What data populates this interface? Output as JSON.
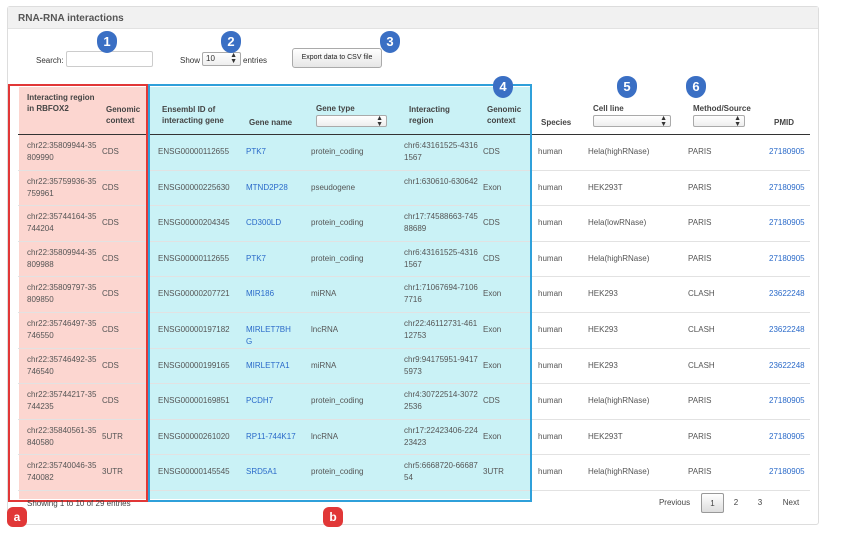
{
  "panel": {
    "title": "RNA-RNA interactions"
  },
  "controls": {
    "search_label": "Search:",
    "search_value": "",
    "show_label": "Show",
    "show_value": "10",
    "entries_label": "entries",
    "export_label": "Export data to CSV file"
  },
  "annotations": {
    "badges": [
      "1",
      "2",
      "3",
      "4",
      "5",
      "6"
    ],
    "region_a": "a",
    "region_b": "b"
  },
  "columns": {
    "rbfox2_region": "Interacting region in RBFOX2",
    "rbfox2_context": "Genomic context",
    "ensembl": "Ensembl ID of interacting gene",
    "gene_name": "Gene name",
    "gene_type": "Gene type",
    "inter_region": "Interacting region",
    "inter_context": "Genomic context",
    "species": "Species",
    "cell_line": "Cell line",
    "method": "Method/Source",
    "pmid": "PMID"
  },
  "rows": [
    {
      "r_region": "chr22:35809944-35809990",
      "r_context": "CDS",
      "ensembl": "ENSG00000112655",
      "gene": "PTK7",
      "type": "protein_coding",
      "i_region": "chr6:43161525-43161567",
      "i_context": "CDS",
      "species": "human",
      "cell": "Hela(highRNase)",
      "method": "PARIS",
      "pmid": "27180905"
    },
    {
      "r_region": "chr22:35759936-35759961",
      "r_context": "CDS",
      "ensembl": "ENSG00000225630",
      "gene": "MTND2P28",
      "type": "pseudogene",
      "i_region": "chr1:630610-630642",
      "i_context": "Exon",
      "species": "human",
      "cell": "HEK293T",
      "method": "PARIS",
      "pmid": "27180905"
    },
    {
      "r_region": "chr22:35744164-35744204",
      "r_context": "CDS",
      "ensembl": "ENSG00000204345",
      "gene": "CD300LD",
      "type": "protein_coding",
      "i_region": "chr17:74588663-74588689",
      "i_context": "CDS",
      "species": "human",
      "cell": "Hela(lowRNase)",
      "method": "PARIS",
      "pmid": "27180905"
    },
    {
      "r_region": "chr22:35809944-35809988",
      "r_context": "CDS",
      "ensembl": "ENSG00000112655",
      "gene": "PTK7",
      "type": "protein_coding",
      "i_region": "chr6:43161525-43161567",
      "i_context": "CDS",
      "species": "human",
      "cell": "Hela(highRNase)",
      "method": "PARIS",
      "pmid": "27180905"
    },
    {
      "r_region": "chr22:35809797-35809850",
      "r_context": "CDS",
      "ensembl": "ENSG00000207721",
      "gene": "MIR186",
      "type": "miRNA",
      "i_region": "chr1:71067694-71067716",
      "i_context": "Exon",
      "species": "human",
      "cell": "HEK293",
      "method": "CLASH",
      "pmid": "23622248"
    },
    {
      "r_region": "chr22:35746497-35746550",
      "r_context": "CDS",
      "ensembl": "ENSG00000197182",
      "gene": "MIRLET7BHG",
      "type": "lncRNA",
      "i_region": "chr22:46112731-46112753",
      "i_context": "Exon",
      "species": "human",
      "cell": "HEK293",
      "method": "CLASH",
      "pmid": "23622248"
    },
    {
      "r_region": "chr22:35746492-35746540",
      "r_context": "CDS",
      "ensembl": "ENSG00000199165",
      "gene": "MIRLET7A1",
      "type": "miRNA",
      "i_region": "chr9:94175951-94175973",
      "i_context": "Exon",
      "species": "human",
      "cell": "HEK293",
      "method": "CLASH",
      "pmid": "23622248"
    },
    {
      "r_region": "chr22:35744217-35744235",
      "r_context": "CDS",
      "ensembl": "ENSG00000169851",
      "gene": "PCDH7",
      "type": "protein_coding",
      "i_region": "chr4:30722514-30722536",
      "i_context": "CDS",
      "species": "human",
      "cell": "Hela(highRNase)",
      "method": "PARIS",
      "pmid": "27180905"
    },
    {
      "r_region": "chr22:35840561-35840580",
      "r_context": "5UTR",
      "ensembl": "ENSG00000261020",
      "gene": "RP11-744K17",
      "type": "lncRNA",
      "i_region": "chr17:22423406-22423423",
      "i_context": "Exon",
      "species": "human",
      "cell": "HEK293T",
      "method": "PARIS",
      "pmid": "27180905"
    },
    {
      "r_region": "chr22:35740046-35740082",
      "r_context": "3UTR",
      "ensembl": "ENSG00000145545",
      "gene": "SRD5A1",
      "type": "protein_coding",
      "i_region": "chr5:6668720-6668754",
      "i_context": "3UTR",
      "species": "human",
      "cell": "Hela(highRNase)",
      "method": "PARIS",
      "pmid": "27180905"
    }
  ],
  "footer": {
    "info": "Showing 1 to 10 of 29 entries",
    "previous": "Previous",
    "pages": [
      "1",
      "2",
      "3"
    ],
    "next": "Next"
  },
  "colors": {
    "badge_blue": "#3a6fc4",
    "badge_red": "#e13737",
    "link": "#2a6ac9",
    "box_blue": "#2fa0da"
  }
}
